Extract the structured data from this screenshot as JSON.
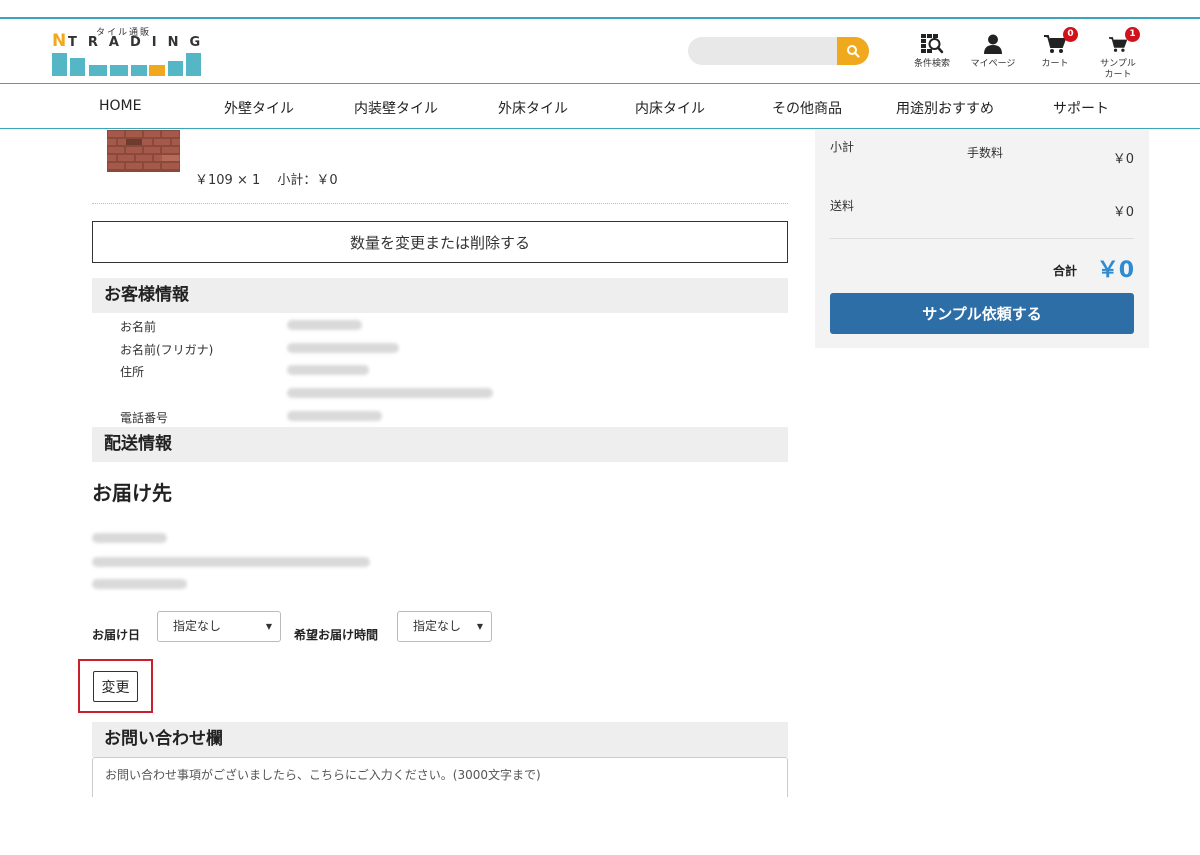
{
  "brand": {
    "initial": "N",
    "tagline": "タイル通販",
    "name": "TRADING",
    "accent": "#f0a81c",
    "teal": "#55b6c6"
  },
  "search": {
    "placeholder": "",
    "icon": "search-icon"
  },
  "header_icons": [
    {
      "name": "condition-search",
      "label": "条件検索",
      "icon": "tile-search-icon"
    },
    {
      "name": "mypage",
      "label": "マイページ",
      "icon": "user-icon"
    },
    {
      "name": "cart",
      "label": "カート",
      "icon": "cart-icon",
      "badge": "0"
    },
    {
      "name": "sample-cart",
      "label_line1": "サンプル",
      "label_line2": "カート",
      "icon": "cart-icon",
      "badge": "1"
    }
  ],
  "nav": [
    "HOME",
    "外壁タイル",
    "内装壁タイル",
    "外床タイル",
    "内床タイル",
    "その他商品",
    "用途別おすすめ",
    "サポート"
  ],
  "cart_item": {
    "price_line": "￥109 × 1　 小計：￥0"
  },
  "change_qty_label": "数量を変更または削除する",
  "customer": {
    "heading": "お客様情報",
    "fields": [
      "お名前",
      "お名前(フリガナ)",
      "住所",
      "電話番号"
    ]
  },
  "shipping": {
    "heading": "配送情報",
    "destination_title": "お届け先",
    "delivery_date_label": "お届け日",
    "delivery_date_value": "指定なし",
    "delivery_time_label": "希望お届け時間",
    "delivery_time_value": "指定なし",
    "change_button": "変更"
  },
  "inquiry": {
    "heading": "お問い合わせ欄",
    "placeholder": "お問い合わせ事項がございましたら、こちらにご入力ください。(3000文字まで)"
  },
  "summary": {
    "subtotal_label": "小計",
    "fee_label": "手数料",
    "fee_value": "￥0",
    "shipping_label": "送料",
    "shipping_value": "￥0",
    "total_label": "合計",
    "total_value": "￥0",
    "submit_label": "サンプル依頼する"
  }
}
